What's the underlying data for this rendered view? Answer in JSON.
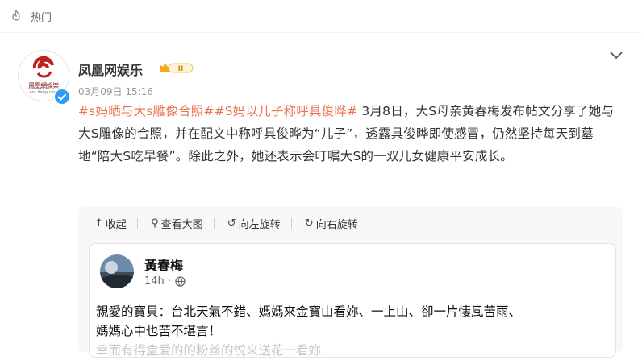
{
  "header": {
    "hot_label": "热门"
  },
  "author": {
    "name": "凤凰网娱乐",
    "avatar_text": "鳳凰網娛樂",
    "avatar_url": "ent.ifeng.com",
    "vip_level": "II",
    "timestamp": "03月09日 15:16"
  },
  "post": {
    "tag1": "#s妈晒与大s雕像合照#",
    "tag2": "#S妈以儿子称呼具俊晔#",
    "text": " 3月8日，大S母亲黄春梅发布帖文分享了她与大S雕像的合照，并在配文中称呼具俊晔为“儿子”，透露具俊晔即使感冒，仍然坚持每天到墓地“陪大S吃早餐”。除此之外，她还表示会叮嘱大S的一双儿女健康平安成长。"
  },
  "toolbar": {
    "collapse": "收起",
    "view_large": "查看大图",
    "rotate_left": "向左旋转",
    "rotate_right": "向右旋转"
  },
  "embedded": {
    "name": "黃春梅",
    "time": "14h · ",
    "line1": "親愛的寶貝：台北天氣不錯、媽媽來金寶山看妳、一上山、卻一片悽風苦雨、",
    "line2": "媽媽心中也苦不堪言！",
    "line3": "幸而有得盒爱的的粉丝的悦来送花一看妳"
  },
  "colors": {
    "accent": "#eb7350",
    "verify": "#2d9cf5",
    "vip": "#f5a623"
  }
}
